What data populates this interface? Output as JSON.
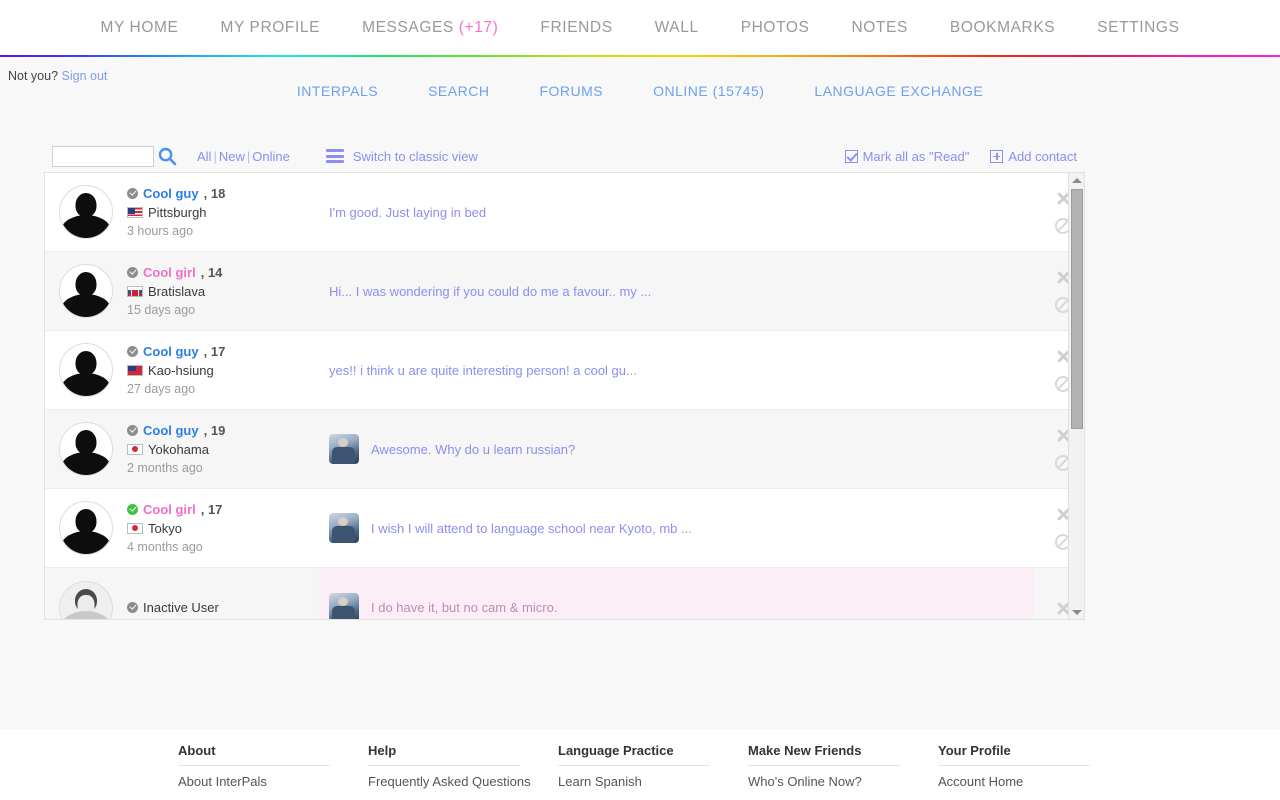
{
  "topnav": {
    "items": [
      {
        "label": "MY HOME",
        "badge": ""
      },
      {
        "label": "MY PROFILE",
        "badge": ""
      },
      {
        "label": "MESSAGES",
        "badge": "(+17)"
      },
      {
        "label": "FRIENDS",
        "badge": ""
      },
      {
        "label": "WALL",
        "badge": ""
      },
      {
        "label": "PHOTOS",
        "badge": ""
      },
      {
        "label": "NOTES",
        "badge": ""
      },
      {
        "label": "BOOKMARKS",
        "badge": ""
      },
      {
        "label": "SETTINGS",
        "badge": ""
      }
    ]
  },
  "subbar": {
    "not_you_text": "Not you?",
    "sign_out": "Sign out",
    "links": [
      {
        "label": "INTERPALS"
      },
      {
        "label": "SEARCH"
      },
      {
        "label": "FORUMS"
      },
      {
        "label": "ONLINE (15745)"
      },
      {
        "label": "LANGUAGE EXCHANGE"
      }
    ]
  },
  "toolbar": {
    "search_value": "",
    "search_placeholder": "",
    "filter_all": "All",
    "filter_new": "New",
    "filter_online": "Online",
    "separator": "|",
    "switch_view": "Switch to classic view",
    "mark_all_read": "Mark all as \"Read\"",
    "add_contact": "Add contact"
  },
  "messages": {
    "rows": [
      {
        "username": "Cool guy",
        "gender": "male",
        "age": ", 18",
        "online": false,
        "city": "Pittsburgh",
        "flag": "us",
        "time": "3 hours ago",
        "preview": "I'm good. Just laying in bed",
        "has_thumb": false,
        "unread": false,
        "inactive": false
      },
      {
        "username": "Cool girl",
        "gender": "female",
        "age": ", 14",
        "online": false,
        "city": "Bratislava",
        "flag": "sk",
        "time": "15 days ago",
        "preview": "Hi... I was wondering if you could do me a favour.. my ...",
        "has_thumb": false,
        "unread": false,
        "inactive": false
      },
      {
        "username": "Cool guy",
        "gender": "male",
        "age": ", 17",
        "online": false,
        "city": "Kao-hsiung",
        "flag": "tw",
        "time": "27 days ago",
        "preview": "yes!! i think u are quite interesting person! a cool gu...",
        "has_thumb": false,
        "unread": false,
        "inactive": false
      },
      {
        "username": "Cool guy",
        "gender": "male",
        "age": ", 19",
        "online": false,
        "city": "Yokohama",
        "flag": "jp",
        "time": "2 months ago",
        "preview": "Awesome. Why do u learn russian?",
        "has_thumb": true,
        "unread": false,
        "inactive": false
      },
      {
        "username": "Cool girl",
        "gender": "female",
        "age": ", 17",
        "online": true,
        "city": "Tokyo",
        "flag": "jp",
        "time": "4 months ago",
        "preview": "I wish I will attend to language school near Kyoto, mb ...",
        "has_thumb": true,
        "unread": false,
        "inactive": false
      },
      {
        "username": "Inactive User",
        "gender": "plain",
        "age": "",
        "online": false,
        "city": "",
        "flag": "",
        "time": "",
        "preview": "I do have it, but no cam & micro.",
        "has_thumb": true,
        "unread": true,
        "inactive": true
      }
    ]
  },
  "footer": {
    "columns": [
      {
        "title": "About",
        "links": [
          "About InterPals"
        ]
      },
      {
        "title": "Help",
        "links": [
          "Frequently Asked Questions"
        ]
      },
      {
        "title": "Language Practice",
        "links": [
          "Learn Spanish"
        ]
      },
      {
        "title": "Make New Friends",
        "links": [
          "Who's Online Now?"
        ]
      },
      {
        "title": "Your Profile",
        "links": [
          "Account Home"
        ]
      }
    ]
  },
  "colors": {
    "link_blue": "#6fa0f0",
    "link_periwinkle": "#8d8ef0",
    "male_name": "#2a7fe8",
    "female_name": "#f26fc8",
    "badge_pink": "#f46fd0",
    "unread_bg": "#fceef7",
    "online_green": "#3fc23f"
  }
}
